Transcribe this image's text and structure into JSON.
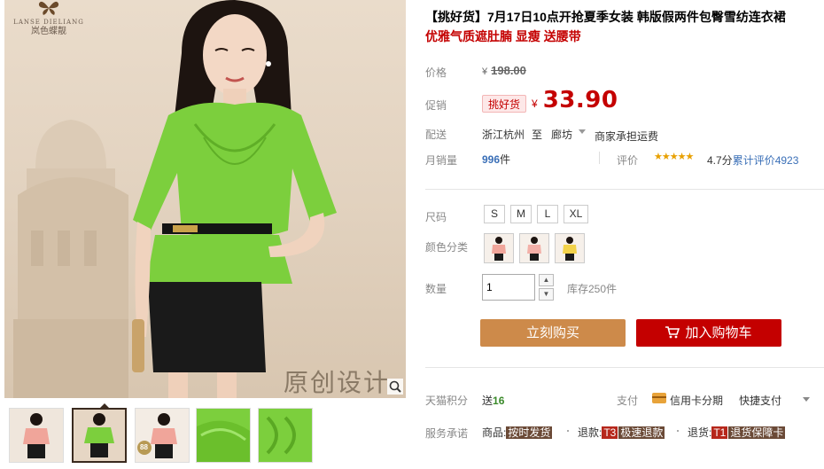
{
  "brand": {
    "name_en": "LANSE DIELIANG",
    "name_cn": "岚色蝶靓"
  },
  "gallery": {
    "watermark": "原创设计",
    "thumb_badge": "88"
  },
  "product": {
    "title": "【挑好货】7月17日10点开抢夏季女装 韩版假两件包臀雪纺连衣裙",
    "subtitle": "优雅气质遮肚腩 显瘦 送腰带"
  },
  "price": {
    "label": "价格",
    "currency": "¥",
    "original": "198.00"
  },
  "promo": {
    "label": "促销",
    "badge": "挑好货",
    "currency": "¥",
    "price": "33.90"
  },
  "shipping": {
    "label": "配送",
    "from": "浙江杭州",
    "to_word": "至",
    "destination": "廊坊",
    "fee": "商家承担运费"
  },
  "sales": {
    "label": "月销量",
    "count": "996",
    "unit": "件",
    "rating_label": "评价",
    "stars": "★★★★★",
    "score": "4.7分",
    "review_text": "累计评价",
    "review_count": "4923"
  },
  "size": {
    "label": "尺码",
    "options": [
      "S",
      "M",
      "L",
      "XL"
    ]
  },
  "color": {
    "label": "颜色分类",
    "swatches": [
      "#f0a59a",
      "#f3b0a8",
      "#f2d24a"
    ]
  },
  "quantity": {
    "label": "数量",
    "value": "1",
    "up": "▲",
    "down": "▼",
    "stock": "库存250件"
  },
  "actions": {
    "buy_now": "立刻购买",
    "add_to_cart": "加入购物车"
  },
  "points": {
    "label": "天猫积分",
    "send": "送",
    "value": "16"
  },
  "payment": {
    "label": "支付",
    "card": "信用卡分期",
    "quick": "快捷支付"
  },
  "service": {
    "label": "服务承诺",
    "items": [
      {
        "prefix": "商品:",
        "tag": "按时发货",
        "t": ""
      },
      {
        "prefix": "退款:",
        "tag": "极速退款",
        "t": "T3"
      },
      {
        "prefix": "退货:",
        "tag": "退货保障卡",
        "t": "T1"
      }
    ]
  },
  "colors": {
    "accent_red": "#c40000",
    "buy_orange": "#cd8a4a",
    "link_blue": "#3a6fb7",
    "blouse_green": "#7ccf3d"
  }
}
